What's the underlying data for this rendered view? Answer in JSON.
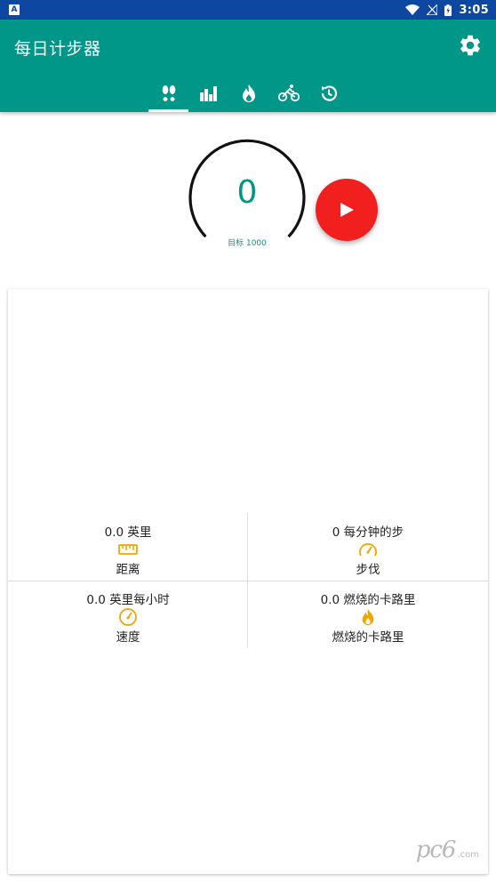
{
  "status_bar": {
    "app_icon_letter": "A",
    "time": "3:05",
    "icons": [
      "wifi-icon",
      "signal-icon",
      "battery-icon"
    ]
  },
  "app_bar": {
    "title": "每日计步器",
    "settings_icon": "gear-icon",
    "background": "#009688",
    "tabs": [
      {
        "icon": "footsteps-icon",
        "active": true
      },
      {
        "icon": "bar-chart-icon",
        "active": false
      },
      {
        "icon": "flame-icon",
        "active": false
      },
      {
        "icon": "bicycle-icon",
        "active": false
      },
      {
        "icon": "history-icon",
        "active": false
      }
    ]
  },
  "tracker": {
    "steps": "0",
    "goal_label": "目标 1000",
    "play_icon": "play-icon",
    "play_color": "#f21f1f"
  },
  "stats": [
    {
      "value": "0.0 英里",
      "label": "距离",
      "icon": "ruler-icon"
    },
    {
      "value": "0 每分钟的步",
      "label": "步伐",
      "icon": "speedometer-icon"
    },
    {
      "value": "0.0 英里每小时",
      "label": "速度",
      "icon": "speedometer-icon"
    },
    {
      "value": "0.0 燃烧的卡路里",
      "label": "燃烧的卡路里",
      "icon": "flame-icon"
    }
  ],
  "watermark": {
    "text": "pc6",
    "suffix": ".com"
  },
  "accent_color": "#f0a500"
}
